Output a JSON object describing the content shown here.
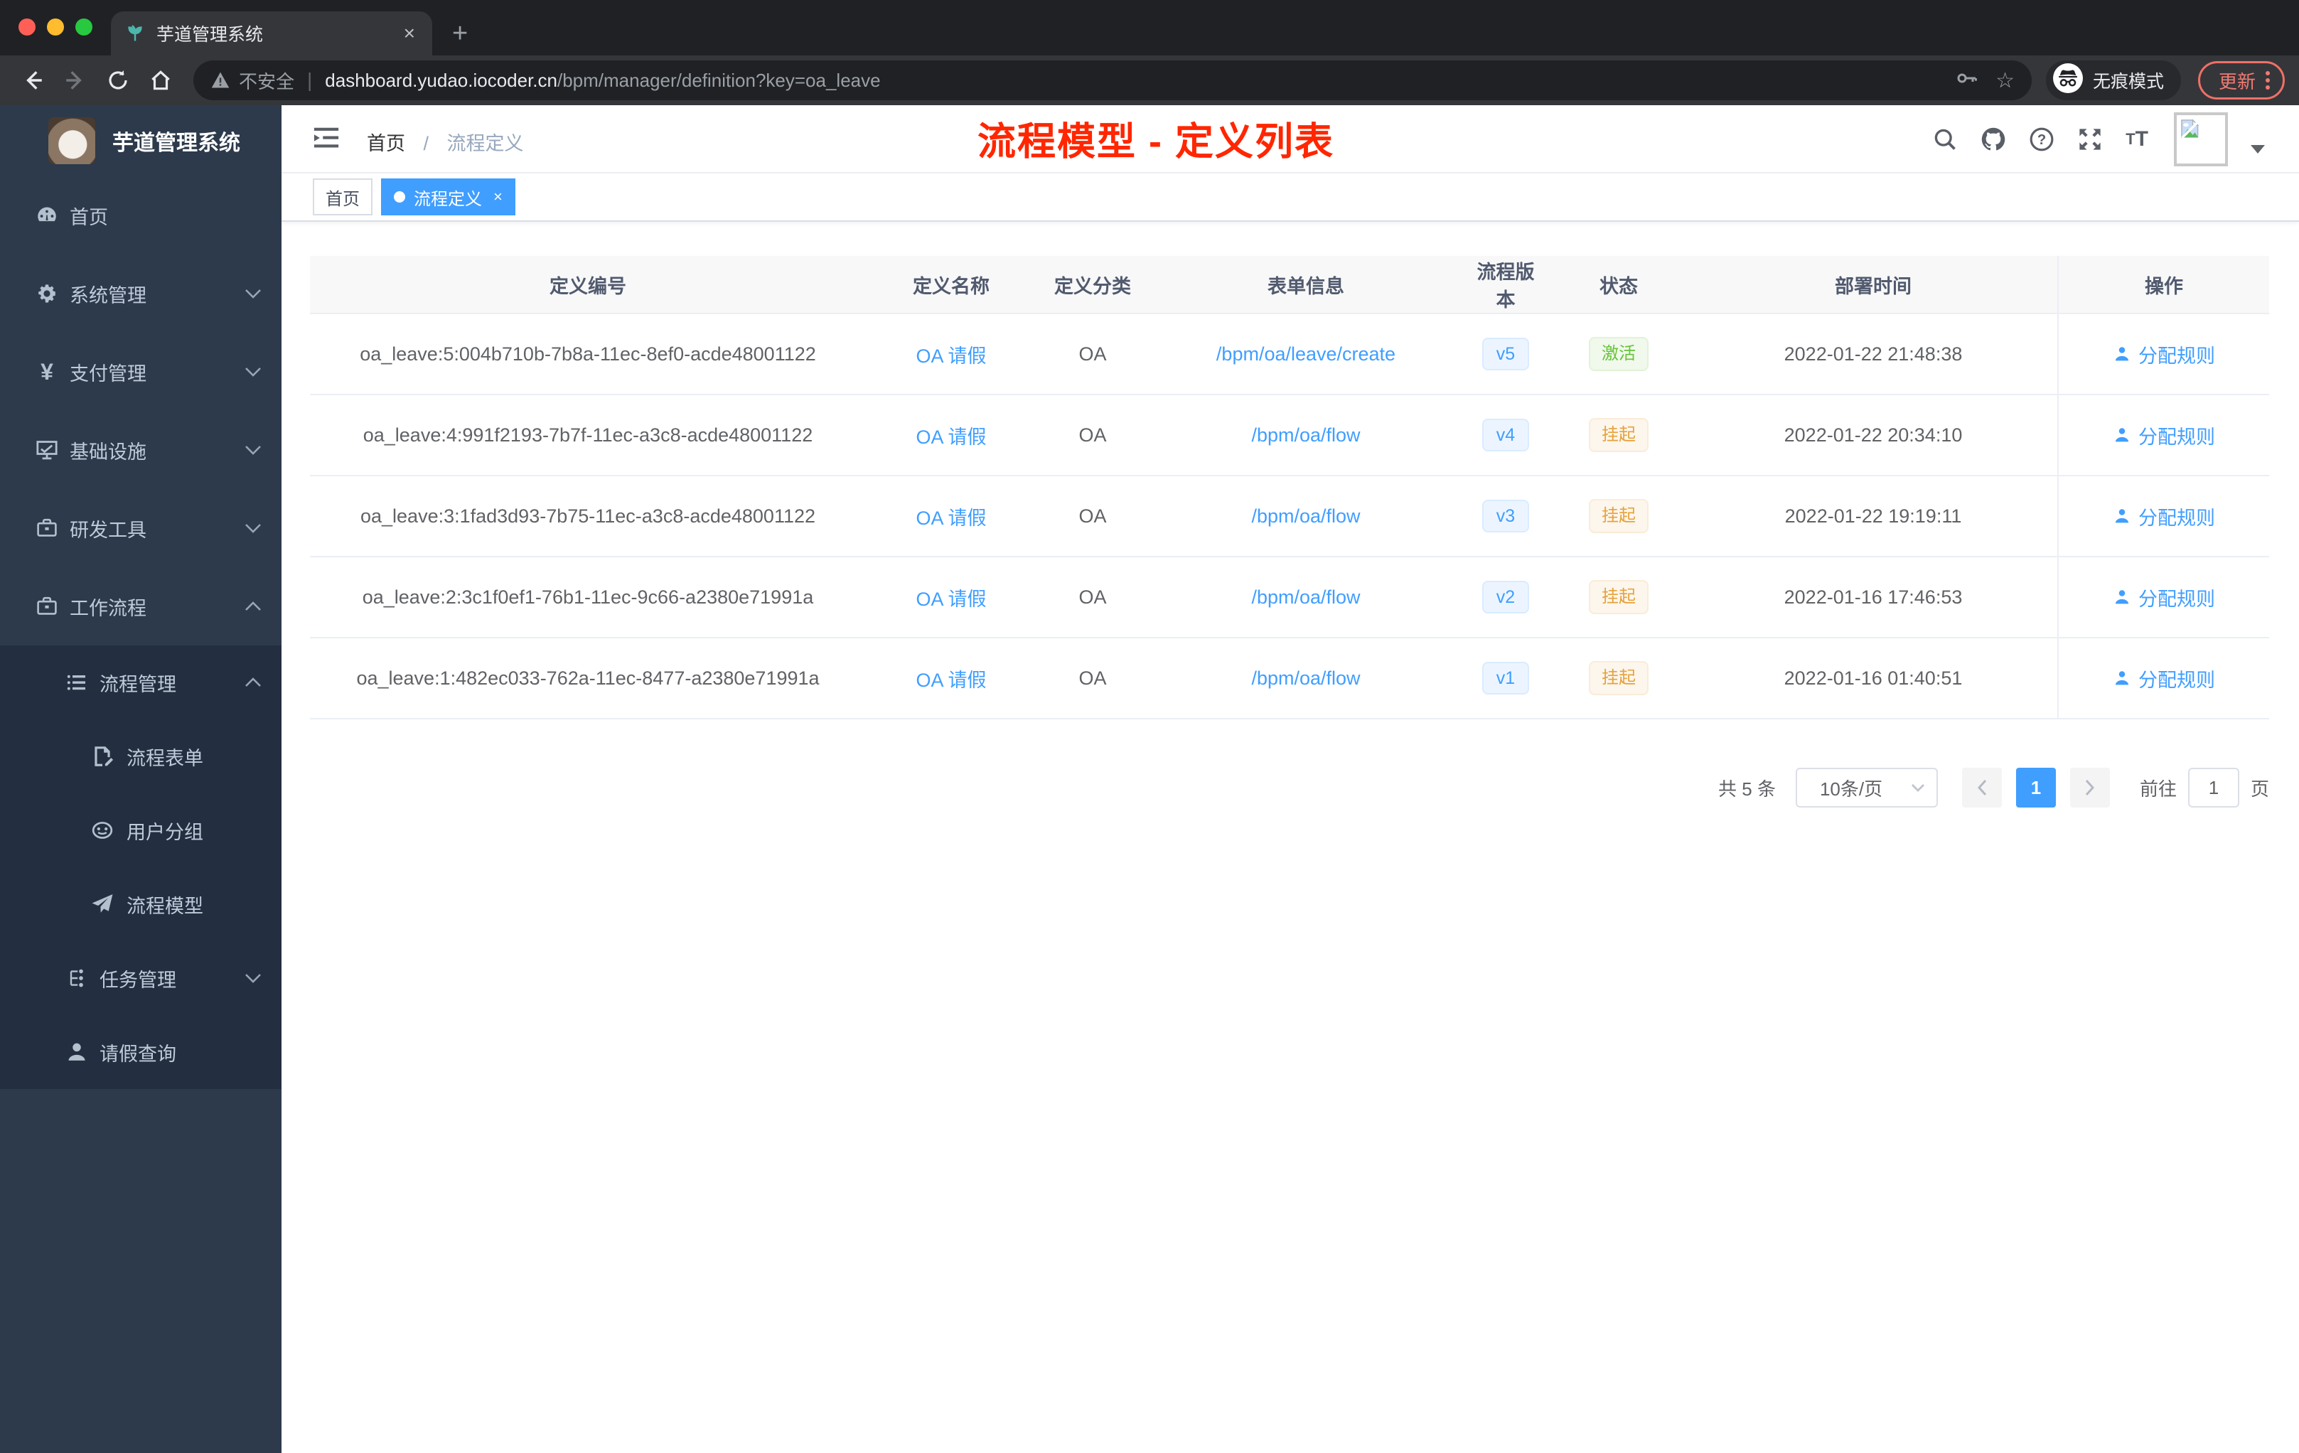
{
  "browser": {
    "tab": {
      "title": "芋道管理系统",
      "close_glyph": "×",
      "new_tab_glyph": "+"
    },
    "address": {
      "security": "不安全",
      "separator": "|",
      "domain": "dashboard.yudao.iocoder.cn",
      "path": "/bpm/manager/definition?key=oa_leave"
    },
    "chips": {
      "incognito": "无痕模式",
      "update": "更新"
    }
  },
  "sidebar": {
    "logo_title": "芋道管理系统",
    "menu": [
      {
        "label": "首页",
        "icon": "dashboard",
        "level": 1
      },
      {
        "label": "系统管理",
        "icon": "gear",
        "level": 1,
        "chevron": "down"
      },
      {
        "label": "支付管理",
        "icon": "yen",
        "level": 1,
        "chevron": "down"
      },
      {
        "label": "基础设施",
        "icon": "monitor",
        "level": 1,
        "chevron": "down"
      },
      {
        "label": "研发工具",
        "icon": "toolbox",
        "level": 1,
        "chevron": "down"
      },
      {
        "label": "工作流程",
        "icon": "briefcase",
        "level": 1,
        "chevron": "up"
      },
      {
        "label": "流程管理",
        "icon": "list",
        "level": 2,
        "chevron": "up",
        "sub": true
      },
      {
        "label": "流程表单",
        "icon": "form-edit",
        "level": 3,
        "sub": true
      },
      {
        "label": "用户分组",
        "icon": "robot",
        "level": 3,
        "sub": true
      },
      {
        "label": "流程模型",
        "icon": "paper-plane",
        "level": 3,
        "sub": true
      },
      {
        "label": "任务管理",
        "icon": "tree",
        "level": 2,
        "chevron": "down",
        "sub": true
      },
      {
        "label": "请假查询",
        "icon": "user",
        "level": 2,
        "sub": true
      }
    ]
  },
  "navbar": {
    "breadcrumb": {
      "home": "首页",
      "separator": "/",
      "current": "流程定义"
    },
    "annotation": "流程模型 - 定义列表"
  },
  "tags": [
    {
      "label": "首页",
      "active": false
    },
    {
      "label": "流程定义",
      "active": true,
      "close_glyph": "×"
    }
  ],
  "table": {
    "columns": [
      "定义编号",
      "定义名称",
      "定义分类",
      "表单信息",
      "流程版本",
      "状态",
      "部署时间",
      "操作"
    ],
    "rows": [
      {
        "id": "oa_leave:5:004b710b-7b8a-11ec-8ef0-acde48001122",
        "name": "OA 请假",
        "category": "OA",
        "form": "/bpm/oa/leave/create",
        "version": "v5",
        "status": "激活",
        "status_type": "active",
        "deployed_at": "2022-01-22 21:48:38",
        "action": "分配规则"
      },
      {
        "id": "oa_leave:4:991f2193-7b7f-11ec-a3c8-acde48001122",
        "name": "OA 请假",
        "category": "OA",
        "form": "/bpm/oa/flow",
        "version": "v4",
        "status": "挂起",
        "status_type": "suspended",
        "deployed_at": "2022-01-22 20:34:10",
        "action": "分配规则"
      },
      {
        "id": "oa_leave:3:1fad3d93-7b75-11ec-a3c8-acde48001122",
        "name": "OA 请假",
        "category": "OA",
        "form": "/bpm/oa/flow",
        "version": "v3",
        "status": "挂起",
        "status_type": "suspended",
        "deployed_at": "2022-01-22 19:19:11",
        "action": "分配规则"
      },
      {
        "id": "oa_leave:2:3c1f0ef1-76b1-11ec-9c66-a2380e71991a",
        "name": "OA 请假",
        "category": "OA",
        "form": "/bpm/oa/flow",
        "version": "v2",
        "status": "挂起",
        "status_type": "suspended",
        "deployed_at": "2022-01-16 17:46:53",
        "action": "分配规则"
      },
      {
        "id": "oa_leave:1:482ec033-762a-11ec-8477-a2380e71991a",
        "name": "OA 请假",
        "category": "OA",
        "form": "/bpm/oa/flow",
        "version": "v1",
        "status": "挂起",
        "status_type": "suspended",
        "deployed_at": "2022-01-16 01:40:51",
        "action": "分配规则"
      }
    ]
  },
  "pagination": {
    "total": "共 5 条",
    "page_size": "10条/页",
    "current_page": "1",
    "goto_label": "前往",
    "page_unit": "页"
  },
  "colors": {
    "accent": "#409eff",
    "annotation_red": "#ff2600",
    "status_active_green": "#67c23a",
    "status_suspended_orange": "#e6a23c",
    "sidebar_bg": "#2d3a4b",
    "sidebar_sub_bg": "#232f40",
    "tag_active_blue": "#409eff"
  }
}
